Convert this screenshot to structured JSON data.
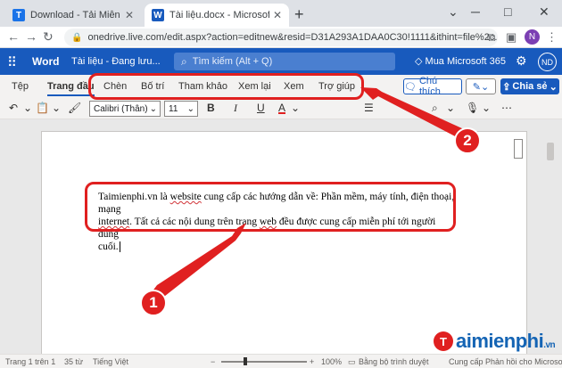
{
  "browser": {
    "tabs": [
      {
        "title": "Download - Tải Miễn Phí VN - Ph",
        "favicon": "T",
        "favicon_color": "#1a73e8"
      },
      {
        "title": "Tài liệu.docx - Microsoft Word Or",
        "favicon": "W",
        "favicon_color": "#185abd"
      }
    ],
    "new_tab": "+",
    "url": "onedrive.live.com/edit.aspx?action=editnew&resid=D31A293A1DAA0C30!1111&ithint=file%2c...",
    "profile_initial": "N"
  },
  "word": {
    "app_name": "Word",
    "doc_status": "Tài liệu - Đang lưu...",
    "search_placeholder": "Tìm kiếm (Alt + Q)",
    "buy_label": "Mua Microsoft 365",
    "user_initials": "ND",
    "accent": "#185abd"
  },
  "ribbon": {
    "tabs": [
      "Tệp",
      "Trang đầu",
      "Chèn",
      "Bố trí",
      "Tham khảo",
      "Xem lại",
      "Xem",
      "Trợ giúp"
    ],
    "active_tab": "Trang đầu",
    "comment_button": "Chú thích",
    "share_button": "Chia sẻ"
  },
  "toolbar": {
    "font_name": "Calibri (Thân)",
    "font_size": "11"
  },
  "document": {
    "text_line1_prefix": "Taimienphi.vn là ",
    "text_line1_misspelled": "website",
    "text_line1_rest": " cung cấp các hướng dẫn về: Phần mềm, máy tính, điện thoại, mạng",
    "text_line2_misspelled": "internet",
    "text_line2_rest": ". Tất cả các nội dung trên trang ",
    "text_line2_misspelled2": "web",
    "text_line2_end": " đều được cung cấp miễn phí tới người dùng",
    "text_line3": "cuối."
  },
  "statusbar": {
    "page": "Trang 1 trên 1",
    "words": "35 từ",
    "language": "Tiếng Việt",
    "zoom": "100%",
    "browser_status": "Bằng bộ trình duyệt",
    "feedback": "Cung cấp Phản hồi cho Microsoft"
  },
  "annotations": {
    "marker1": "1",
    "marker2": "2",
    "color": "#e02020"
  },
  "watermark": {
    "logo_letter": "T",
    "text": "aimienphi",
    "sub": ".vn"
  }
}
